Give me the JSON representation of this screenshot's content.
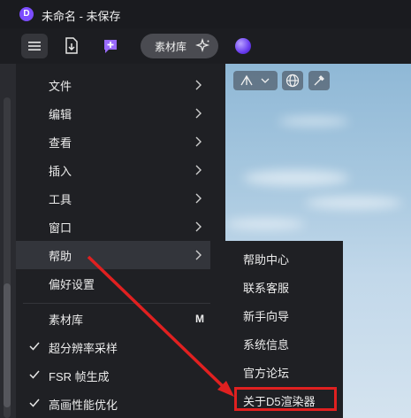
{
  "window": {
    "title": "未命名 - 未保存",
    "logo_letter": "D"
  },
  "toolbar": {
    "assets_label": "素材库"
  },
  "colors": {
    "accent": "#7c4dff",
    "highlight": "#e02020",
    "menu_bg": "#1f2024",
    "active_bg": "#33353b"
  },
  "main_menu": {
    "items": [
      {
        "label": "文件"
      },
      {
        "label": "编辑"
      },
      {
        "label": "查看"
      },
      {
        "label": "插入"
      },
      {
        "label": "工具"
      },
      {
        "label": "窗口"
      },
      {
        "label": "帮助"
      },
      {
        "label": "偏好设置"
      },
      {
        "label": "素材库",
        "shortcut": "M"
      },
      {
        "label": "超分辨率采样",
        "checked": true
      },
      {
        "label": "FSR 帧生成",
        "checked": true
      },
      {
        "label": "高画性能优化",
        "checked": true
      }
    ]
  },
  "help_submenu": {
    "items": [
      {
        "label": "帮助中心"
      },
      {
        "label": "联系客服"
      },
      {
        "label": "新手向导"
      },
      {
        "label": "系统信息"
      },
      {
        "label": "官方论坛"
      },
      {
        "label": "关于D5渲染器"
      }
    ]
  }
}
